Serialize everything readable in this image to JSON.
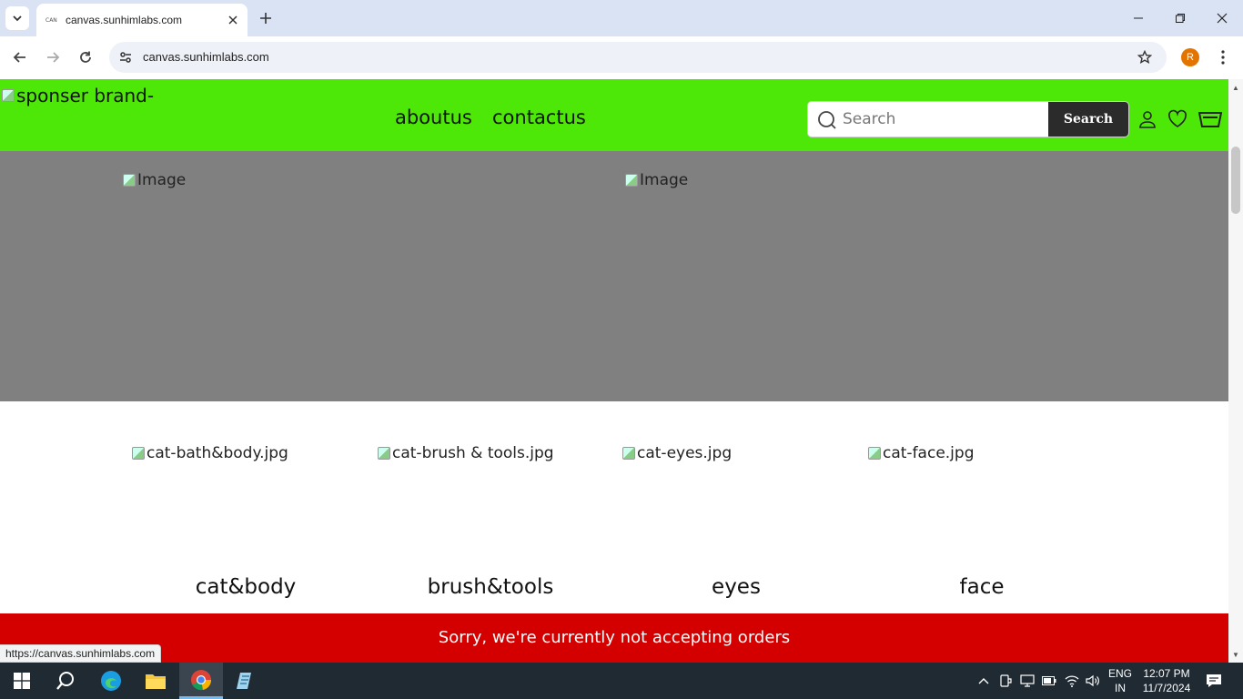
{
  "browser": {
    "tab_title": "canvas.sunhimlabs.com",
    "tab_favicon_text": "CAN",
    "url": "canvas.sunhimlabs.com",
    "profile_initial": "R",
    "status_url": "https://canvas.sunhimlabs.com"
  },
  "site": {
    "logo_alt": "sponser brand-",
    "nav": [
      {
        "label": "aboutus"
      },
      {
        "label": "contactus"
      }
    ],
    "search": {
      "placeholder": "Search",
      "button_label": "Search"
    },
    "banner_images": [
      {
        "alt": "Image"
      },
      {
        "alt": "Image"
      }
    ],
    "categories": [
      {
        "image_alt": "cat-bath&body.jpg",
        "name": "cat&body"
      },
      {
        "image_alt": "cat-brush & tools.jpg",
        "name": "brush&tools"
      },
      {
        "image_alt": "cat-eyes.jpg",
        "name": "eyes"
      },
      {
        "image_alt": "cat-face.jpg",
        "name": "face"
      }
    ],
    "notice": "Sorry, we're currently not accepting orders",
    "colors": {
      "header_bg": "#4ee808",
      "banner_bg": "#808080",
      "notice_bg": "#d40000",
      "search_button_bg": "#2b2b2b"
    }
  },
  "taskbar": {
    "language_line1": "ENG",
    "language_line2": "IN",
    "time": "12:07 PM",
    "date": "11/7/2024"
  }
}
